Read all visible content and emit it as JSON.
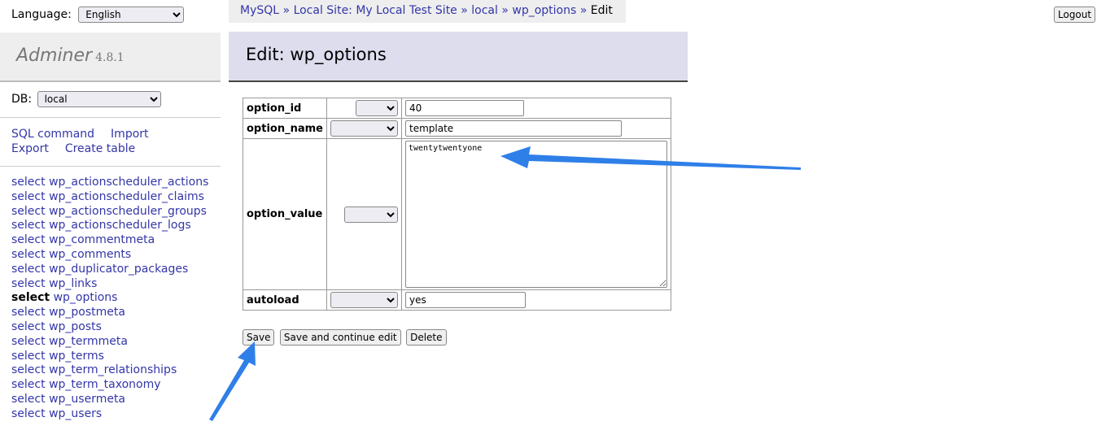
{
  "language": {
    "label": "Language:",
    "selected": "English"
  },
  "logo": {
    "name": "Adminer",
    "version": "4.8.1"
  },
  "db": {
    "label": "DB:",
    "selected": "local"
  },
  "links": {
    "sql_command": "SQL command",
    "import": "Import",
    "export": "Export",
    "create_table": "Create table"
  },
  "tables": [
    {
      "action": "select",
      "name": "wp_actionscheduler_actions"
    },
    {
      "action": "select",
      "name": "wp_actionscheduler_claims"
    },
    {
      "action": "select",
      "name": "wp_actionscheduler_groups"
    },
    {
      "action": "select",
      "name": "wp_actionscheduler_logs"
    },
    {
      "action": "select",
      "name": "wp_commentmeta"
    },
    {
      "action": "select",
      "name": "wp_comments"
    },
    {
      "action": "select",
      "name": "wp_duplicator_packages"
    },
    {
      "action": "select",
      "name": "wp_links"
    },
    {
      "action": "select",
      "name": "wp_options",
      "active": true
    },
    {
      "action": "select",
      "name": "wp_postmeta"
    },
    {
      "action": "select",
      "name": "wp_posts"
    },
    {
      "action": "select",
      "name": "wp_termmeta"
    },
    {
      "action": "select",
      "name": "wp_terms"
    },
    {
      "action": "select",
      "name": "wp_term_relationships"
    },
    {
      "action": "select",
      "name": "wp_term_taxonomy"
    },
    {
      "action": "select",
      "name": "wp_usermeta"
    },
    {
      "action": "select",
      "name": "wp_users"
    }
  ],
  "breadcrumb": {
    "items": [
      "MySQL",
      "Local Site: My Local Test Site",
      "local",
      "wp_options"
    ],
    "current": "Edit",
    "separator": "»"
  },
  "header": {
    "title": "Edit: wp_options"
  },
  "logout": "Logout",
  "fields": {
    "option_id": {
      "label": "option_id",
      "value": "40"
    },
    "option_name": {
      "label": "option_name",
      "value": "template"
    },
    "option_value": {
      "label": "option_value",
      "value": "twentytwentyone"
    },
    "autoload": {
      "label": "autoload",
      "value": "yes"
    }
  },
  "buttons": {
    "save": "Save",
    "save_continue": "Save and continue edit",
    "delete": "Delete"
  },
  "annotation_color": "#2f7fe8"
}
